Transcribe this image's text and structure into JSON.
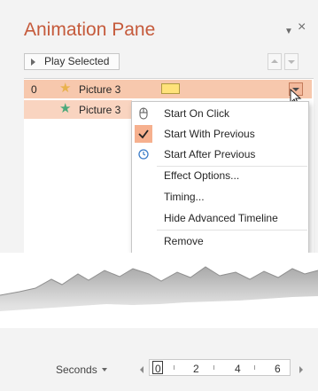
{
  "pane": {
    "title": "Animation Pane"
  },
  "toolbar": {
    "play_label": "Play Selected"
  },
  "animations": [
    {
      "index": "0",
      "name": "Picture 3",
      "effect": "entrance"
    },
    {
      "index": "",
      "name": "Picture 3",
      "effect": "emphasis"
    }
  ],
  "context_menu": {
    "items": [
      {
        "label": "Start On Click",
        "icon": "mouse-click-icon"
      },
      {
        "label": "Start With Previous",
        "icon": "checkmark-icon",
        "checked": true
      },
      {
        "label": "Start After Previous",
        "icon": "clock-icon"
      },
      {
        "label": "Effect Options...",
        "icon": ""
      },
      {
        "label": "Timing...",
        "icon": ""
      },
      {
        "label": "Hide Advanced Timeline",
        "icon": ""
      },
      {
        "label": "Remove",
        "icon": ""
      }
    ]
  },
  "timeline": {
    "unit_label": "Seconds",
    "ticks": [
      "0",
      "2",
      "4",
      "6"
    ]
  },
  "colors": {
    "accent": "#c55a3b",
    "selected_row": "#f7c8ad",
    "entrance_star": "#e9b24d",
    "emphasis_star": "#4ca97b",
    "timing_bar": "#ffe27a",
    "menu_check_bg": "#f6b08e"
  }
}
